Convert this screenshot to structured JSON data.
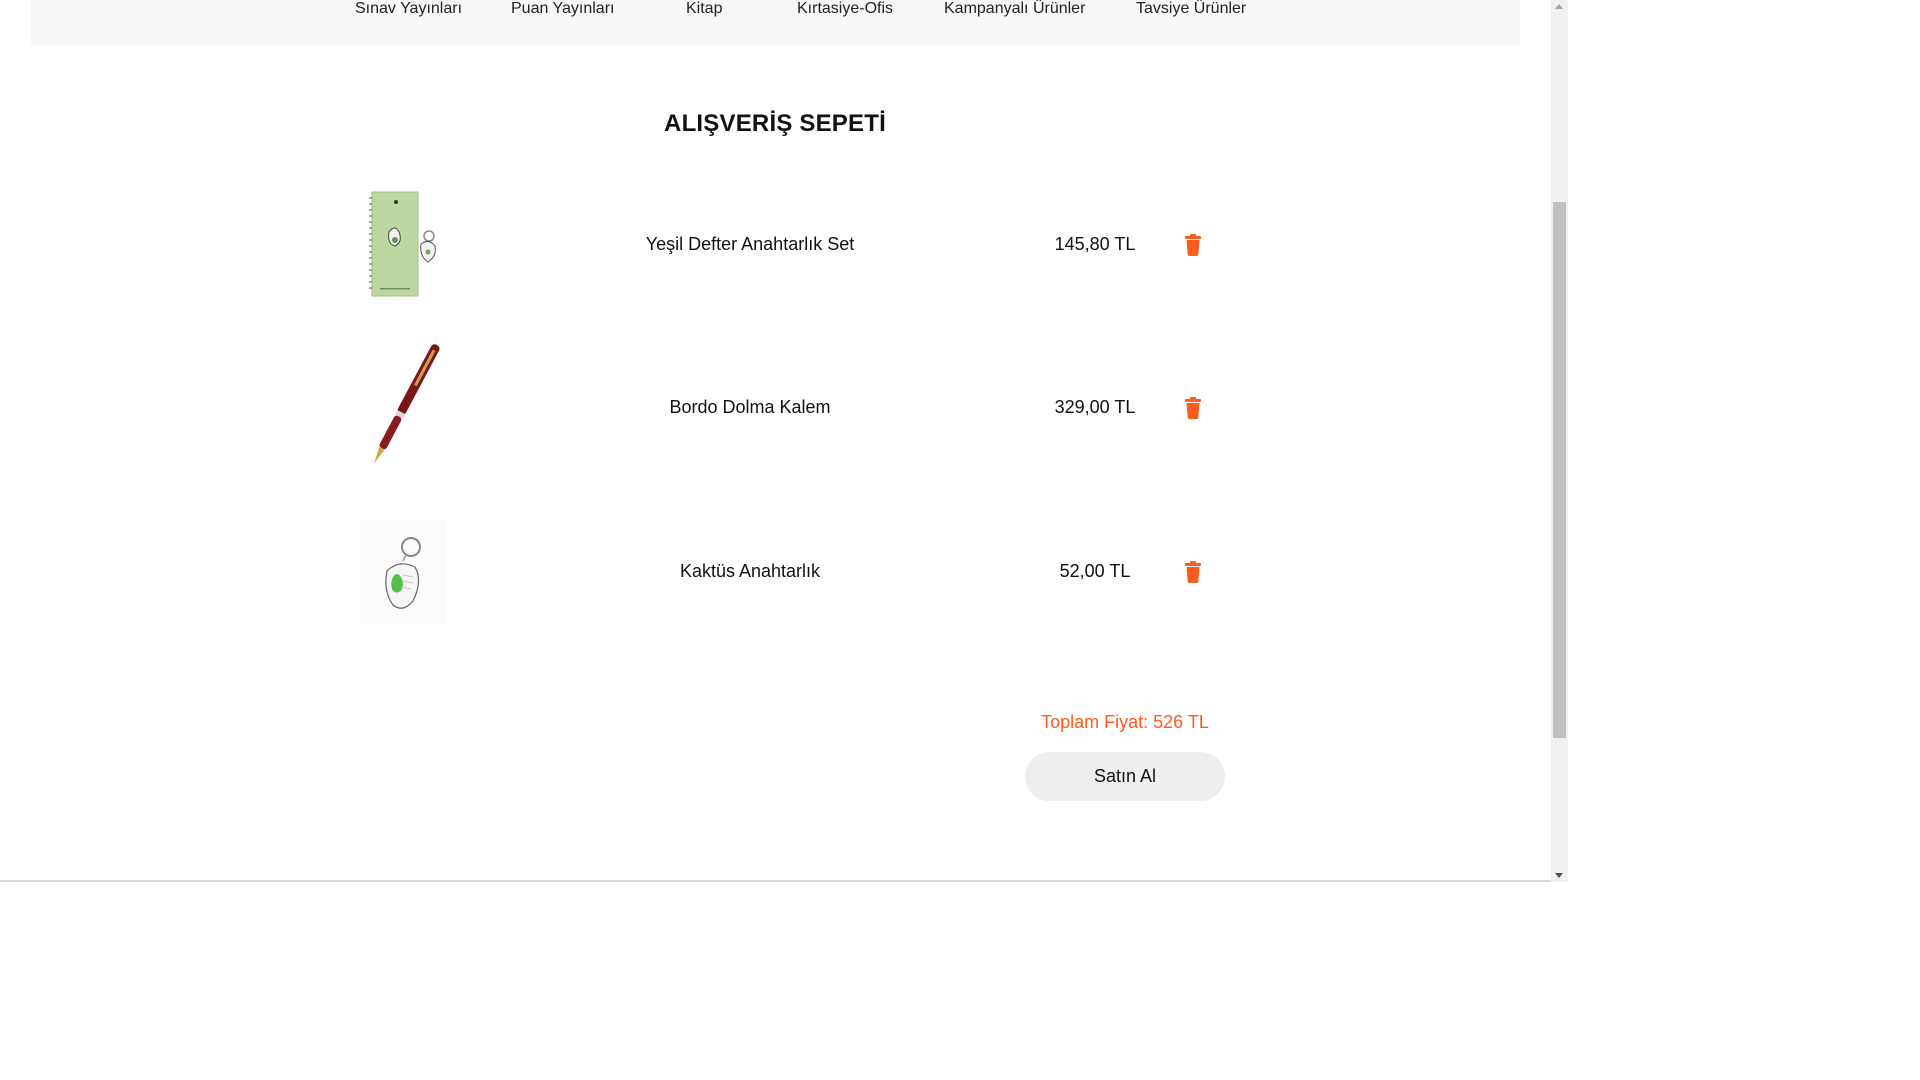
{
  "nav": {
    "items": [
      {
        "label": "Sınav Yayınları"
      },
      {
        "label": "Puan Yayınları"
      },
      {
        "label": "Kitap"
      },
      {
        "label": "Kırtasiye-Ofis"
      },
      {
        "label": "Kampanyalı Ürünler"
      },
      {
        "label": "Tavsiye Ürünler"
      }
    ]
  },
  "cart": {
    "title": "ALIŞVERİŞ SEPETİ",
    "items": [
      {
        "name": "Yeşil Defter Anahtarlık Set",
        "price": "145,80 TL",
        "icon": "trash-icon"
      },
      {
        "name": "Bordo Dolma Kalem",
        "price": "329,00 TL",
        "icon": "trash-icon"
      },
      {
        "name": "Kaktüs Anahtarlık",
        "price": "52,00 TL",
        "icon": "trash-icon"
      }
    ],
    "total": "Toplam Fiyat: 526 TL",
    "buy_label": "Satın Al"
  },
  "colors": {
    "accent": "#ff5a1f",
    "nav_bg": "#f7f7f7",
    "button_bg": "#eeeeee"
  }
}
